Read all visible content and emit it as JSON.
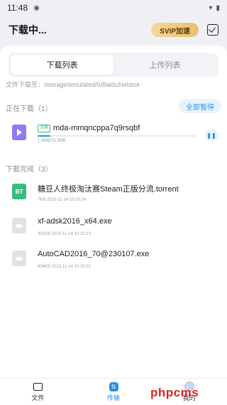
{
  "status_bar": {
    "time": "11:48"
  },
  "header": {
    "title": "下载中...",
    "svip_label": "SVIP加速"
  },
  "tabs": [
    {
      "label": "下载列表",
      "active": true
    },
    {
      "label": "上传列表",
      "active": false
    }
  ],
  "download_path": "文件下载至：/storage/emulated/0/BaiduNetdisk",
  "downloading": {
    "header": "正在下载（1）",
    "pause_all_label": "全部暂停",
    "items": [
      {
        "badge": "流畅",
        "name": "mda-mmqncppa7q9rsqbf",
        "size": "1.4MB/15.5MB",
        "progress": 0.08
      }
    ]
  },
  "completed": {
    "header": "下载完成（3）",
    "items": [
      {
        "icon": "bt-icon",
        "icon_text": "BT",
        "name": "糖豆人终极淘汰赛Steam正版分流.torrent",
        "meta": "7KB 2023-11-14 10:20:34"
      },
      {
        "icon": "cloud-icon",
        "icon_text": "",
        "name": "xf-adsk2016_x64.exe",
        "meta": "302KB 2023-11-14 10:20:13"
      },
      {
        "icon": "cloud-icon",
        "icon_text": "",
        "name": "AutoCAD2016_70@230107.exe",
        "meta": "904KB 2023-11-14 10:20:01"
      }
    ]
  },
  "bottom_nav": [
    {
      "label": "文件",
      "icon": "folder-icon",
      "active": false
    },
    {
      "label": "传输",
      "icon": "transfer-icon",
      "active": true
    },
    {
      "label": "我的",
      "icon": "avatar-icon",
      "active": false
    }
  ],
  "watermark": "phpcms",
  "colors": {
    "accent": "#2b8fe0",
    "svip_gold": "#e9bf6d",
    "bt_green": "#3dbb7e",
    "video_purple": "#8c7cf0"
  }
}
